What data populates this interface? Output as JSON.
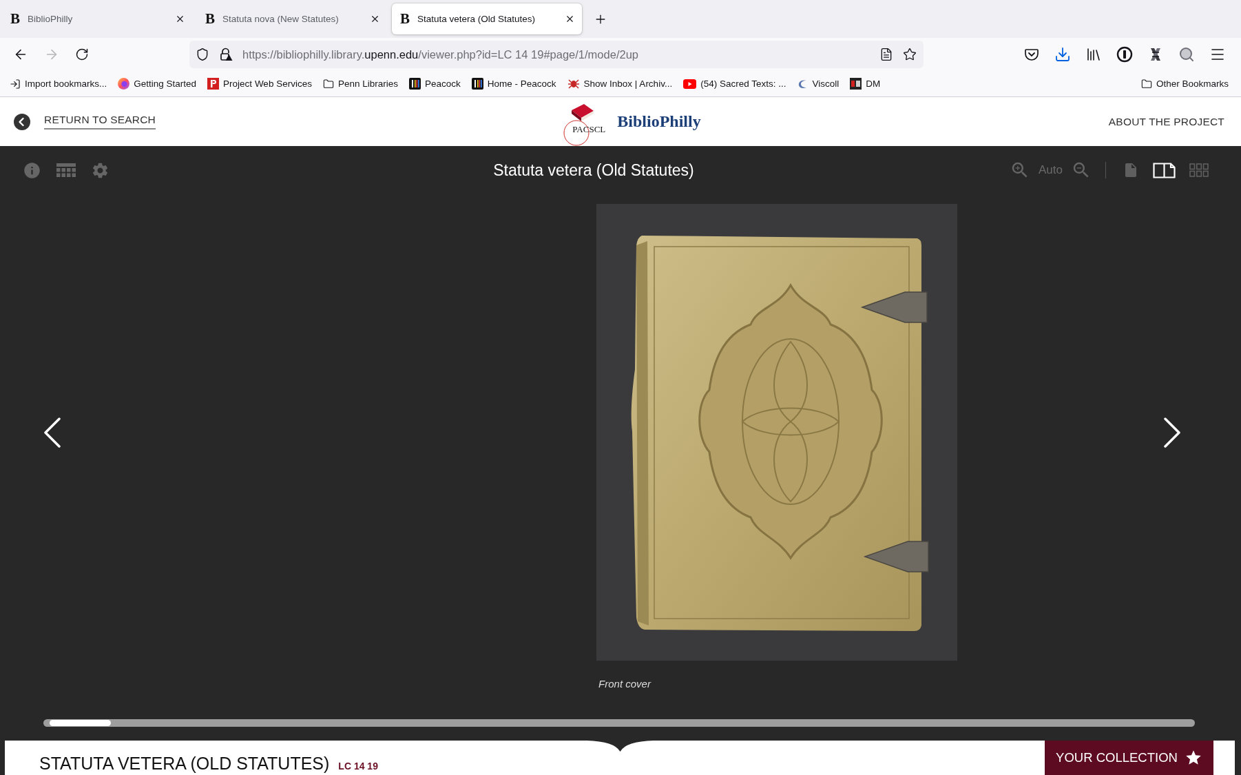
{
  "browser": {
    "tabs": [
      {
        "favicon": "B",
        "title": "BiblioPhilly",
        "selected": false
      },
      {
        "favicon": "B",
        "title": "Statuta nova (New Statutes)",
        "selected": false
      },
      {
        "favicon": "B",
        "title": "Statuta vetera (Old Statutes)",
        "selected": true
      }
    ],
    "nav_buttons": [
      {
        "kind": "back",
        "disabled": false
      },
      {
        "kind": "forward",
        "disabled": true
      },
      {
        "kind": "reload",
        "disabled": false
      }
    ],
    "url": {
      "scheme_host": "https://bibliophilly.library.",
      "domain": "upenn.edu",
      "path": "/viewer.php?id=LC 14 19#page/1/mode/2up"
    },
    "bookmarks": [
      {
        "label": "Import bookmarks...",
        "kind": "import"
      },
      {
        "label": "Getting Started",
        "kind": "flame"
      },
      {
        "label": "Project Web Services",
        "kind": "red-tile"
      },
      {
        "label": "Penn Libraries",
        "kind": "folder"
      },
      {
        "label": "Peacock",
        "kind": "dark-tile"
      },
      {
        "label": "Home - Peacock",
        "kind": "dark-tile"
      },
      {
        "label": "Show Inbox | Archiv...",
        "kind": "bug"
      },
      {
        "label": "(54) Sacred Texts: ...",
        "kind": "play"
      },
      {
        "label": "Viscoll",
        "kind": "crescent"
      },
      {
        "label": "DM",
        "kind": "dm-tile"
      }
    ],
    "other_bookmarks": "Other Bookmarks"
  },
  "site_header": {
    "back_link": "RETURN TO SEARCH",
    "logo_mark": "PACSCL",
    "logo_title": "BiblioPhilly",
    "about_link": "ABOUT THE PROJECT"
  },
  "viewer": {
    "title": "Statuta vetera (Old Statutes)",
    "zoom_label": "Auto",
    "view_modes": [
      {
        "kind": "single",
        "selected": false
      },
      {
        "kind": "two-page",
        "selected": true
      },
      {
        "kind": "thumbnails",
        "selected": false
      }
    ],
    "caption": "Front cover",
    "page_slider": {
      "level": 0
    }
  },
  "info_panel": {
    "title": "STATUTA VETERA (OLD STATUTES)",
    "call_number": "LC 14 19",
    "collection_button": "YOUR COLLECTION"
  }
}
